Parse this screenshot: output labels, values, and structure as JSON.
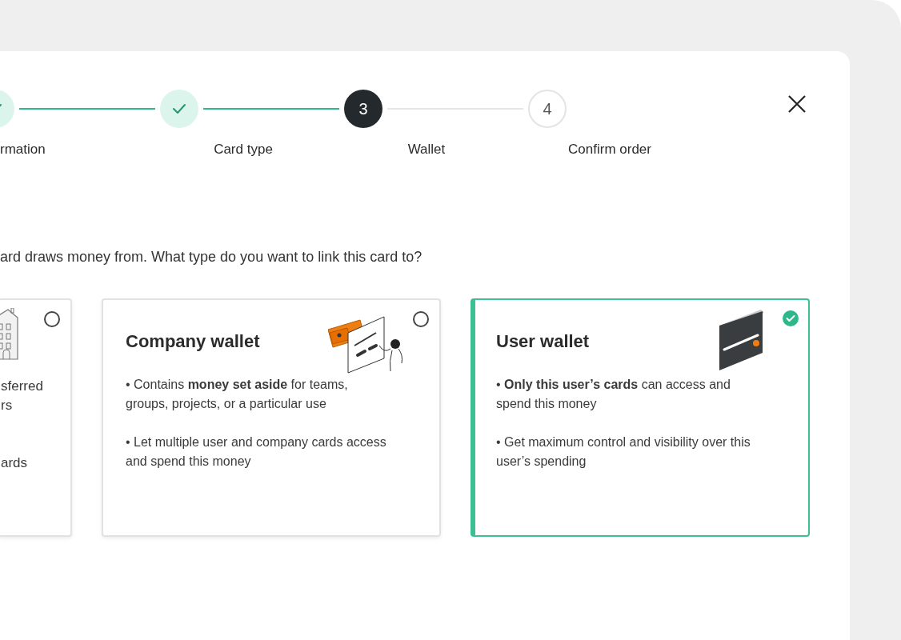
{
  "stepper": {
    "steps": [
      {
        "label": "rmation",
        "kind": "done"
      },
      {
        "label": "Card type",
        "kind": "done"
      },
      {
        "label": "Wallet",
        "kind": "current",
        "number": "3"
      },
      {
        "label": "Confirm order",
        "kind": "pending",
        "number": "4"
      }
    ]
  },
  "intro": "ard draws money from. What type do you want to link this card to?",
  "options": [
    {
      "kind": "partial",
      "selected": false,
      "bullets": [
        [
          "sferred",
          "rs"
        ],
        [
          "ards"
        ]
      ]
    },
    {
      "kind": "company",
      "title": "Company wallet",
      "selected": false,
      "bullets": [
        [
          "• Contains **money set aside** for teams, groups, projects, or a particular use"
        ],
        [
          "• Let multiple user and company cards access and spend this money"
        ]
      ]
    },
    {
      "kind": "user",
      "title": "User wallet",
      "selected": true,
      "bullets": [
        [
          "• **Only this user’s cards** can access and spend this money"
        ],
        [
          "• Get maximum control and visibility over this user’s spending"
        ]
      ]
    }
  ]
}
